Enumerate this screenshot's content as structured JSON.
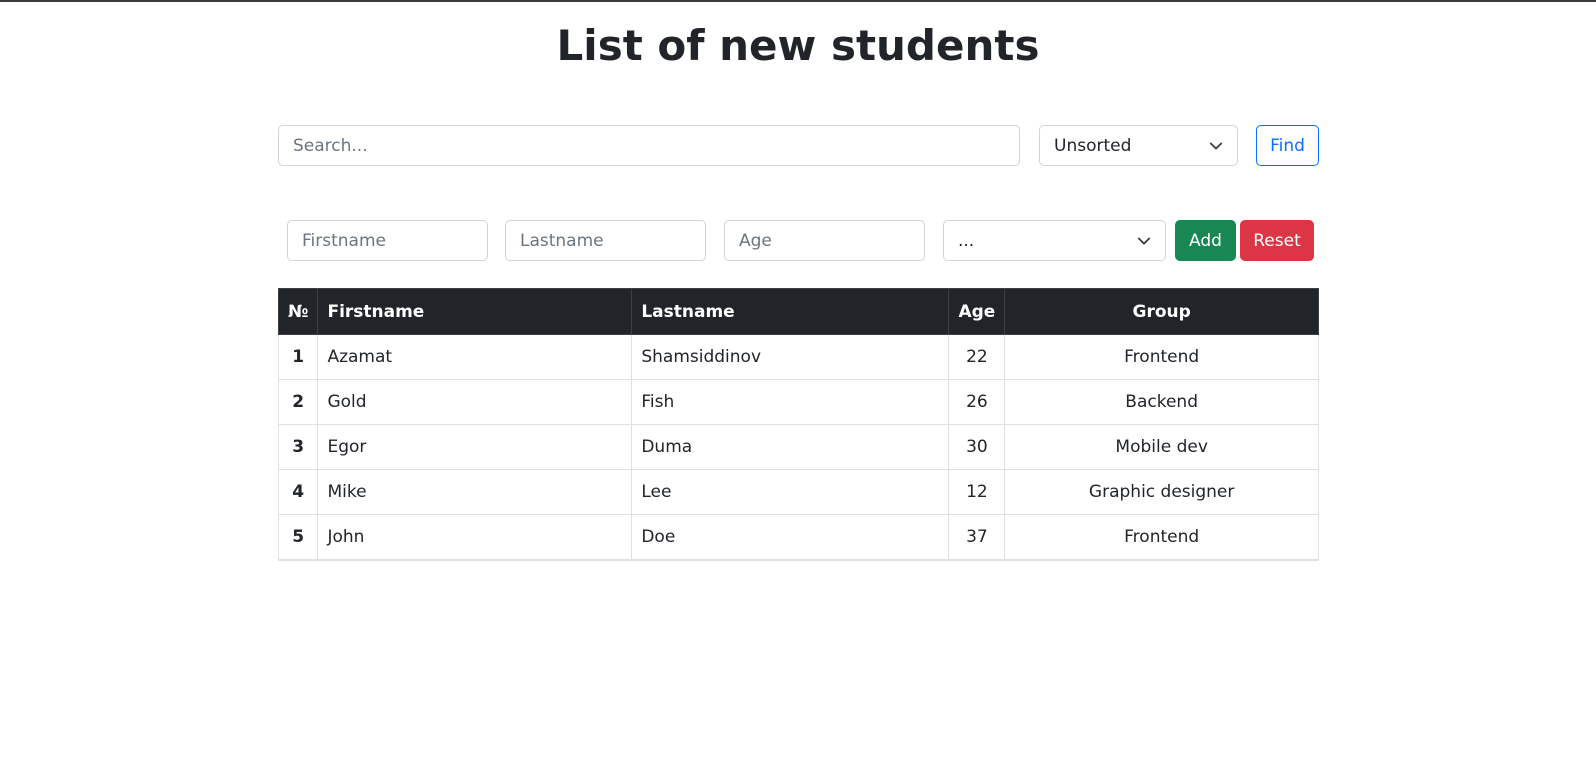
{
  "page": {
    "title": "List of new students"
  },
  "search": {
    "placeholder": "Search...",
    "value": "",
    "sort_selected": "Unsorted",
    "find_label": "Find"
  },
  "form": {
    "firstname_placeholder": "Firstname",
    "lastname_placeholder": "Lastname",
    "age_placeholder": "Age",
    "group_selected": "...",
    "add_label": "Add",
    "reset_label": "Reset"
  },
  "table": {
    "headers": {
      "num": "№",
      "firstname": "Firstname",
      "lastname": "Lastname",
      "age": "Age",
      "group": "Group"
    },
    "rows": [
      {
        "num": "1",
        "firstname": "Azamat",
        "lastname": "Shamsiddinov",
        "age": "22",
        "group": "Frontend"
      },
      {
        "num": "2",
        "firstname": "Gold",
        "lastname": "Fish",
        "age": "26",
        "group": "Backend"
      },
      {
        "num": "3",
        "firstname": "Egor",
        "lastname": "Duma",
        "age": "30",
        "group": "Mobile dev"
      },
      {
        "num": "4",
        "firstname": "Mike",
        "lastname": "Lee",
        "age": "12",
        "group": "Graphic designer"
      },
      {
        "num": "5",
        "firstname": "John",
        "lastname": "Doe",
        "age": "37",
        "group": "Frontend"
      }
    ]
  },
  "icons": {
    "sort_chevron": "chevron-down-icon",
    "group_chevron": "chevron-down-icon"
  },
  "colors": {
    "primary": "#0d6efd",
    "success": "#198754",
    "danger": "#dc3545",
    "table_header": "#212529"
  }
}
